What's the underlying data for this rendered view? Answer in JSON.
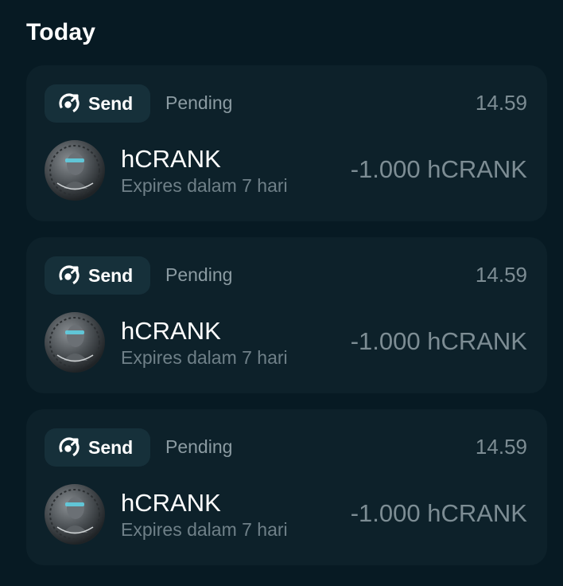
{
  "section": {
    "title": "Today"
  },
  "transactions": [
    {
      "type_label": "Send",
      "status": "Pending",
      "time": "14.59",
      "token_name": "hCRANK",
      "expires": "Expires dalam 7 hari",
      "amount": "-1.000 hCRANK",
      "icon": "send-arrow-icon",
      "avatar": "hcrank-coin-avatar"
    },
    {
      "type_label": "Send",
      "status": "Pending",
      "time": "14.59",
      "token_name": "hCRANK",
      "expires": "Expires dalam 7 hari",
      "amount": "-1.000 hCRANK",
      "icon": "send-arrow-icon",
      "avatar": "hcrank-coin-avatar"
    },
    {
      "type_label": "Send",
      "status": "Pending",
      "time": "14.59",
      "token_name": "hCRANK",
      "expires": "Expires dalam 7 hari",
      "amount": "-1.000 hCRANK",
      "icon": "send-arrow-icon",
      "avatar": "hcrank-coin-avatar"
    }
  ],
  "colors": {
    "background": "#071a23",
    "card": "#0d212a",
    "chip": "#16303a",
    "muted_text": "#7d8d94"
  }
}
